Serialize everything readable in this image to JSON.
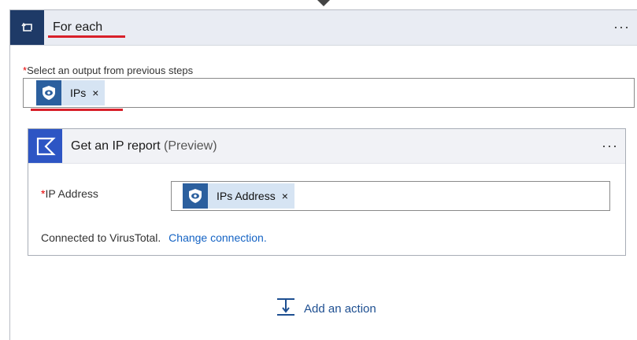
{
  "foreach": {
    "title": "For each",
    "more_label": "···",
    "select_label": "Select an output from previous steps",
    "required_marker": "*",
    "token": {
      "label": "IPs",
      "remove": "×"
    }
  },
  "action_card": {
    "title": "Get an IP report",
    "title_suffix": "(Preview)",
    "more_label": "···",
    "ip_label": "IP Address",
    "required_marker": "*",
    "token": {
      "label": "IPs Address",
      "remove": "×"
    },
    "connected_text": "Connected to VirusTotal.",
    "change_link": "Change connection."
  },
  "add_action": {
    "label": "Add an action"
  },
  "colors": {
    "foreach_icon_bg": "#1e3a67",
    "action_icon_bg": "#2d55c4",
    "token_bg": "#d6e4f3",
    "link": "#1463c4",
    "highlight_underline": "#d8202a"
  }
}
